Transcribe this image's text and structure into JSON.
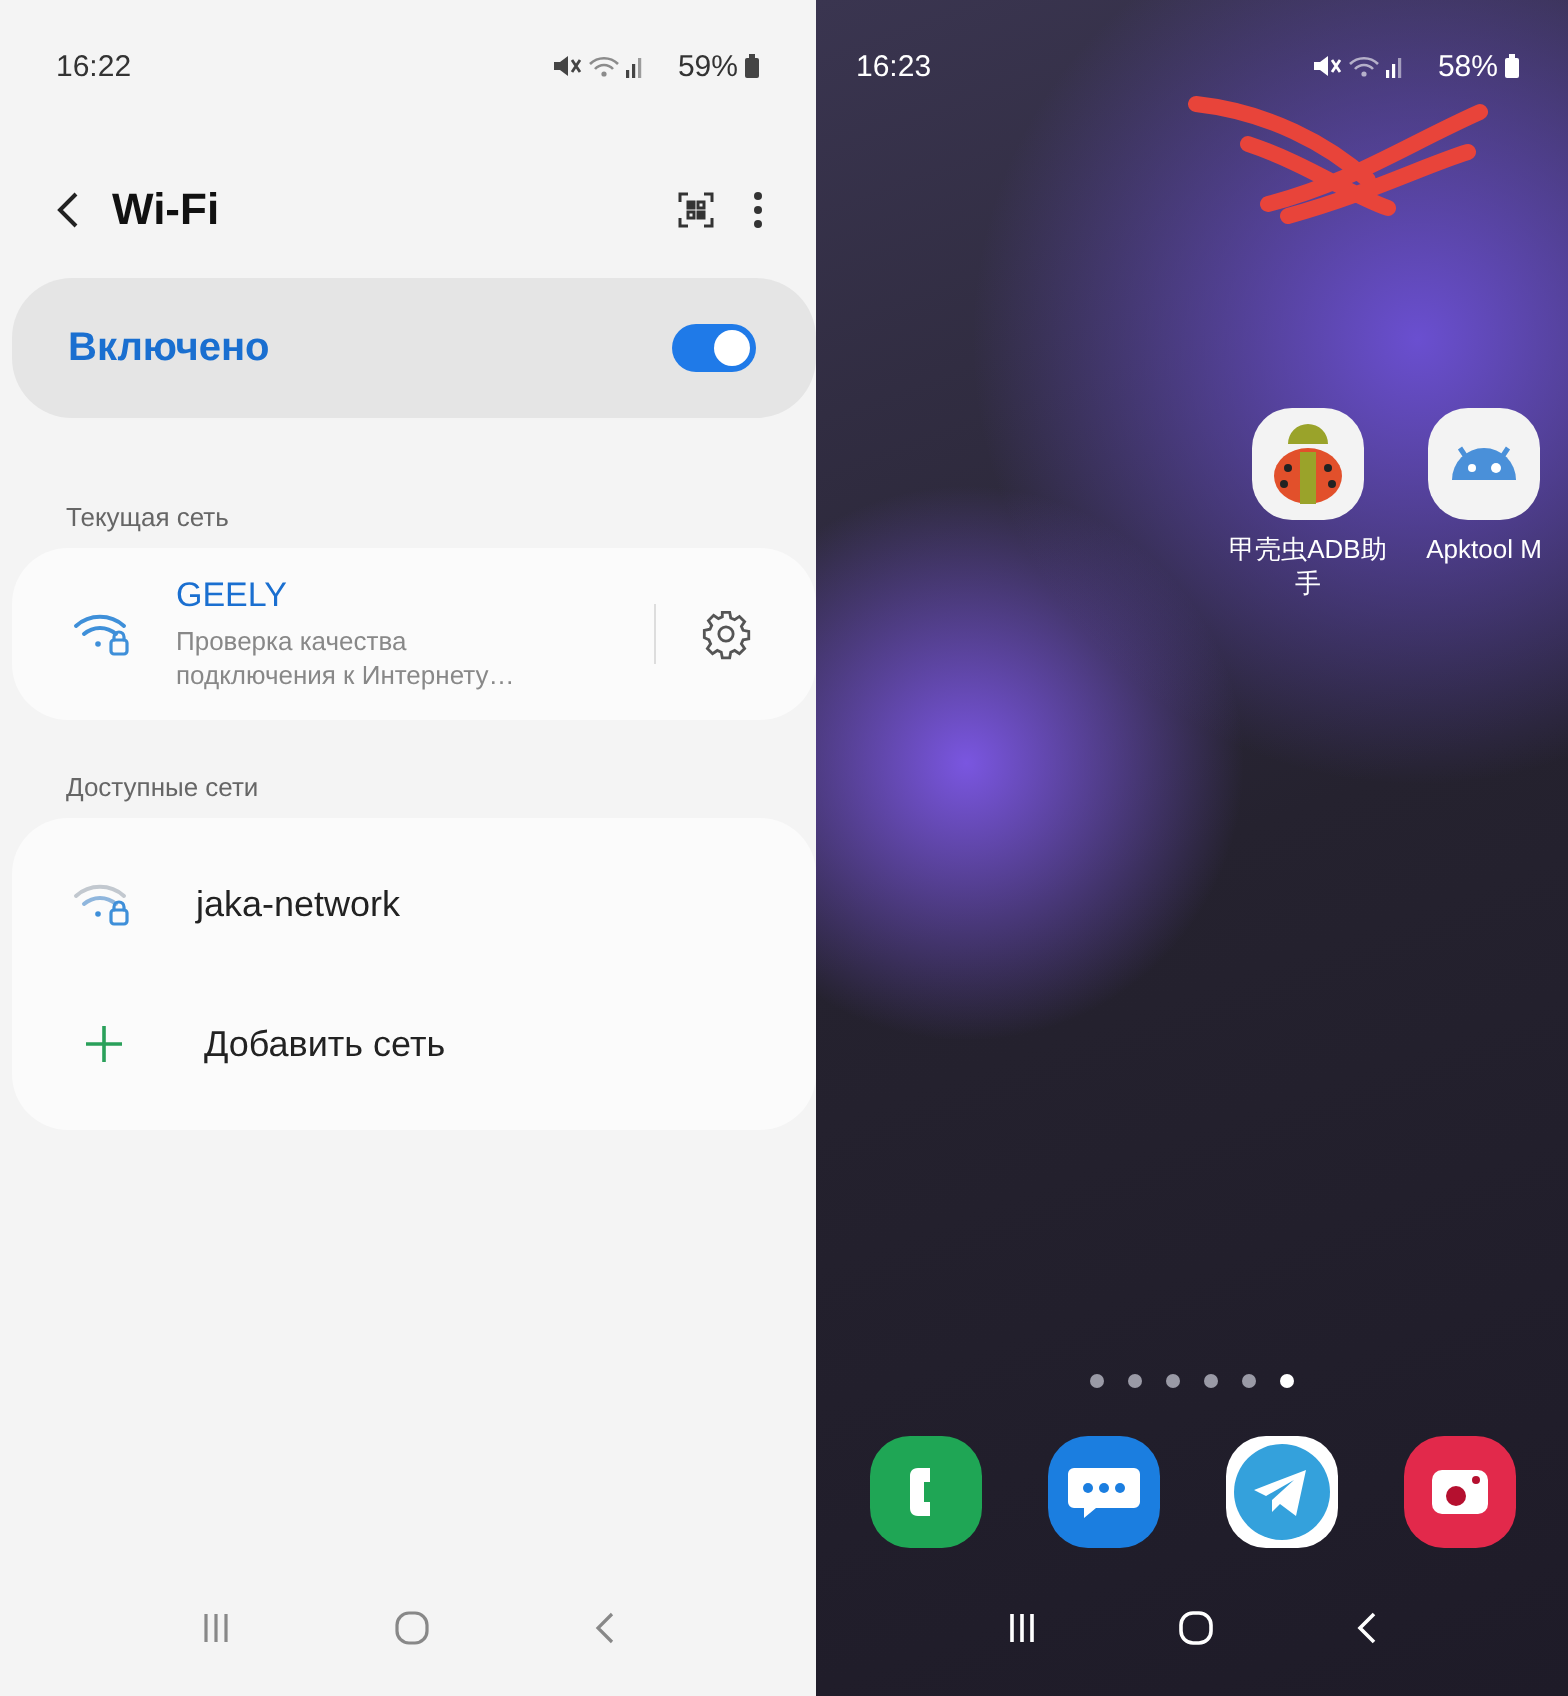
{
  "settings_screen": {
    "status_bar": {
      "time": "16:22",
      "battery": "59%"
    },
    "header": {
      "title": "Wi-Fi"
    },
    "master_switch": {
      "label": "Включено",
      "on": true
    },
    "current_network": {
      "heading": "Текущая сеть",
      "name": "GEELY",
      "status": "Проверка качества подключения к Интернету…"
    },
    "available_networks": {
      "heading": "Доступные сети",
      "networks": [
        {
          "name": "jaka-network"
        }
      ],
      "add_label": "Добавить сеть"
    }
  },
  "home_screen": {
    "status_bar": {
      "time": "16:23",
      "battery": "58%"
    },
    "apps": [
      {
        "label": "甲壳虫ADB助手",
        "kind": "ladybug"
      },
      {
        "label": "Apktool M",
        "kind": "android"
      }
    ],
    "pages": [
      {
        "selected": false
      },
      {
        "selected": false
      },
      {
        "selected": false
      },
      {
        "selected": false
      },
      {
        "selected": false
      },
      {
        "selected": true
      }
    ],
    "dock": [
      {
        "kind": "phone"
      },
      {
        "kind": "messages"
      },
      {
        "kind": "telegram"
      },
      {
        "kind": "camera"
      }
    ]
  }
}
